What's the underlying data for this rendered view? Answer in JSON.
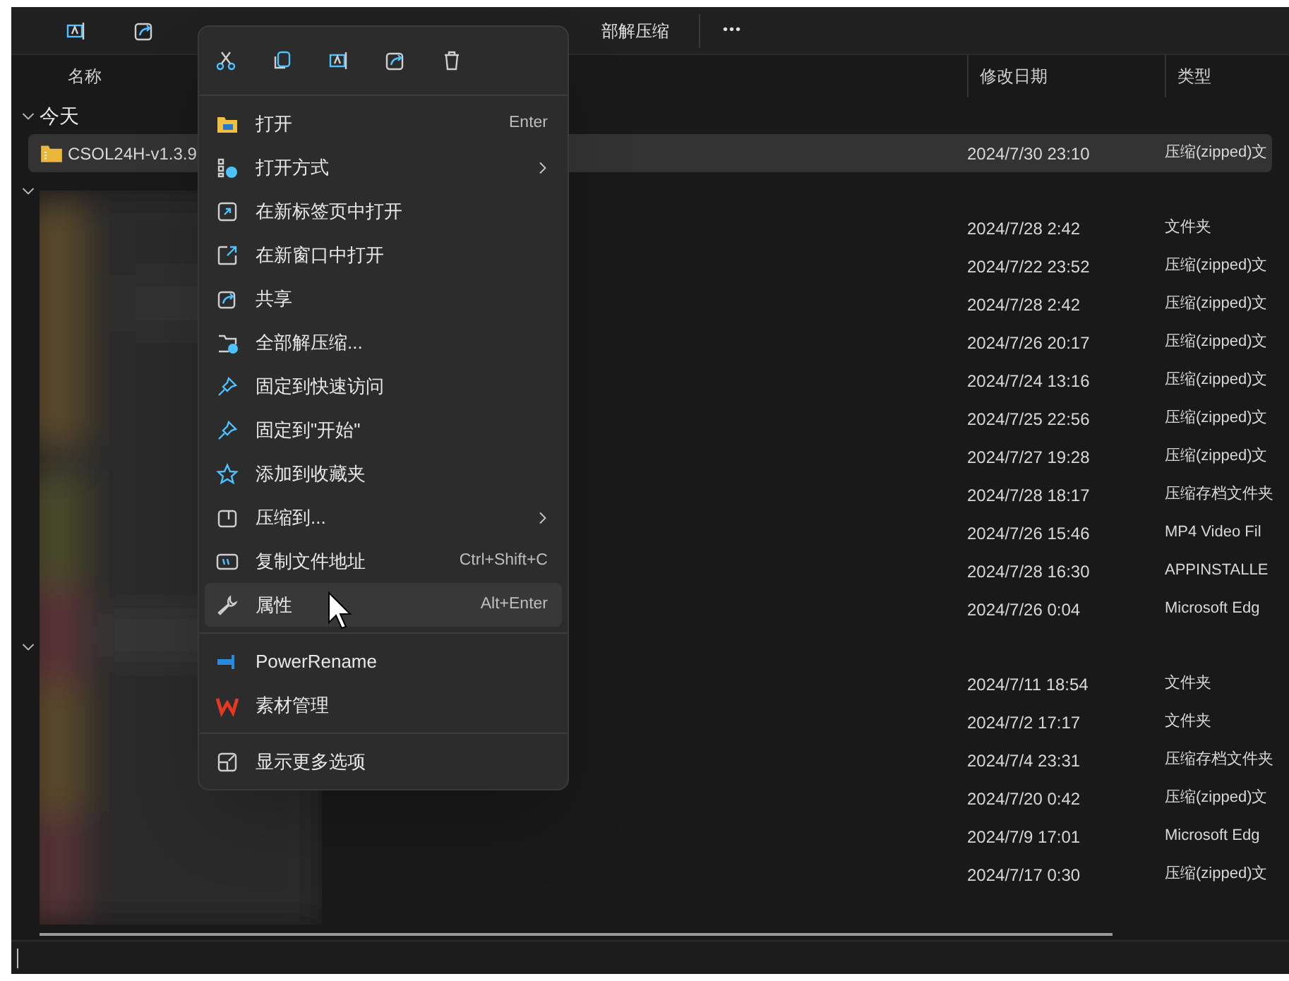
{
  "toolbar": {
    "extract_label": "部解压缩",
    "more": "•••"
  },
  "columns": [
    {
      "label": "名称"
    },
    {
      "label": "修改日期"
    },
    {
      "label": "类型"
    }
  ],
  "groups": [
    {
      "label": "今天",
      "expanded": true,
      "rows": [
        {
          "name": "CSOL24H-v1.3.9",
          "date": "2024/7/30 23:10",
          "type": "压缩(zipped)文",
          "selected": true
        }
      ]
    },
    {
      "expanded": true,
      "rows": [
        {
          "date": "2024/7/28 2:42",
          "type": "文件夹",
          "selected": false
        },
        {
          "date": "2024/7/22 23:52",
          "type": "压缩(zipped)文",
          "selected": false
        },
        {
          "date": "2024/7/28 2:42",
          "type": "压缩(zipped)文",
          "selected": false
        },
        {
          "date": "2024/7/26 20:17",
          "type": "压缩(zipped)文",
          "selected": false
        },
        {
          "date": "2024/7/24 13:16",
          "type": "压缩(zipped)文",
          "selected": false
        },
        {
          "date": "2024/7/25 22:56",
          "type": "压缩(zipped)文",
          "selected": false
        },
        {
          "date": "2024/7/27 19:28",
          "type": "压缩(zipped)文",
          "selected": false
        },
        {
          "date": "2024/7/28 18:17",
          "type": "压缩存档文件夹",
          "selected": false
        },
        {
          "date": "2024/7/26 15:46",
          "type": "MP4 Video Fil",
          "selected": false
        },
        {
          "date": "2024/7/28 16:30",
          "type": "APPINSTALLE",
          "selected": false
        },
        {
          "date": "2024/7/26 0:04",
          "type": "Microsoft Edg",
          "selected": false
        }
      ]
    },
    {
      "expanded": true,
      "rows": [
        {
          "date": "2024/7/11 18:54",
          "type": "文件夹",
          "selected": false
        },
        {
          "date": "2024/7/2 17:17",
          "type": "文件夹",
          "selected": false
        },
        {
          "date": "2024/7/4 23:31",
          "type": "压缩存档文件夹",
          "selected": false
        },
        {
          "date": "2024/7/20 0:42",
          "type": "压缩(zipped)文",
          "selected": false
        },
        {
          "date": "2024/7/9 17:01",
          "type": "Microsoft Edg",
          "selected": false
        },
        {
          "date": "2024/7/17 0:30",
          "type": "压缩(zipped)文",
          "selected": false
        }
      ]
    }
  ],
  "context_menu": {
    "sections": [
      [
        {
          "label": "打开",
          "shortcut": "Enter",
          "submenu": false,
          "selected": false
        },
        {
          "label": "打开方式",
          "submenu": true,
          "selected": false
        },
        {
          "label": "在新标签页中打开",
          "submenu": false,
          "selected": false
        },
        {
          "label": "在新窗口中打开",
          "submenu": false,
          "selected": false
        },
        {
          "label": "共享",
          "submenu": false,
          "selected": false
        },
        {
          "label": "全部解压缩...",
          "submenu": false,
          "selected": false
        },
        {
          "label": "固定到快速访问",
          "submenu": false,
          "selected": false
        },
        {
          "label": "固定到\"开始\"",
          "submenu": false,
          "selected": false
        },
        {
          "label": "添加到收藏夹",
          "submenu": false,
          "selected": false
        },
        {
          "label": "压缩到...",
          "submenu": true,
          "selected": false
        },
        {
          "label": "复制文件地址",
          "shortcut": "Ctrl+Shift+C",
          "submenu": false,
          "selected": false
        },
        {
          "label": "属性",
          "shortcut": "Alt+Enter",
          "submenu": false,
          "selected": true
        }
      ],
      [
        {
          "label": "PowerRename",
          "submenu": false,
          "selected": false
        },
        {
          "label": "素材管理",
          "submenu": false,
          "selected": false
        }
      ],
      [
        {
          "label": "显示更多选项",
          "submenu": false,
          "selected": false
        }
      ]
    ]
  }
}
